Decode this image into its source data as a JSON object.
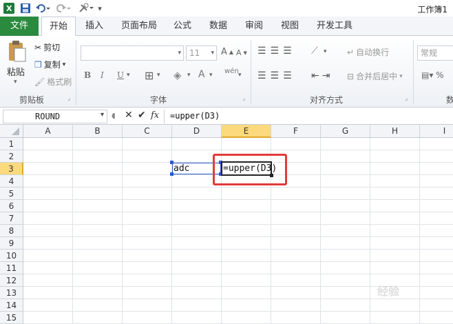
{
  "window": {
    "title": "工作簿1"
  },
  "tabs": [
    {
      "label": "文件"
    },
    {
      "label": "开始"
    },
    {
      "label": "插入"
    },
    {
      "label": "页面布局"
    },
    {
      "label": "公式"
    },
    {
      "label": "数据"
    },
    {
      "label": "审阅"
    },
    {
      "label": "视图"
    },
    {
      "label": "开发工具"
    }
  ],
  "ribbon": {
    "clipboard": {
      "paste": "粘贴",
      "cut": "剪切",
      "copy": "复制",
      "format_painter": "格式刷",
      "group": "剪贴板"
    },
    "font": {
      "size": "11",
      "group": "字体",
      "bold": "B",
      "italic": "I",
      "underline": "U"
    },
    "alignment": {
      "wrap": "自动换行",
      "merge": "合并后居中",
      "group": "对齐方式"
    },
    "number": {
      "format": "常规",
      "group": "数"
    }
  },
  "formula_bar": {
    "name_box": "ROUND",
    "fx": "fx",
    "content": "=upper(D3)"
  },
  "columns": [
    "A",
    "B",
    "C",
    "D",
    "E",
    "F",
    "G",
    "H",
    "I"
  ],
  "rows": [
    "1",
    "2",
    "3",
    "4",
    "5",
    "6",
    "7",
    "8",
    "9",
    "10",
    "11",
    "12",
    "13",
    "14",
    "15"
  ],
  "active_column": "E",
  "active_row": "3",
  "cells": {
    "D3": "adc",
    "E3": "=upper(D3)"
  },
  "watermark": "经验"
}
